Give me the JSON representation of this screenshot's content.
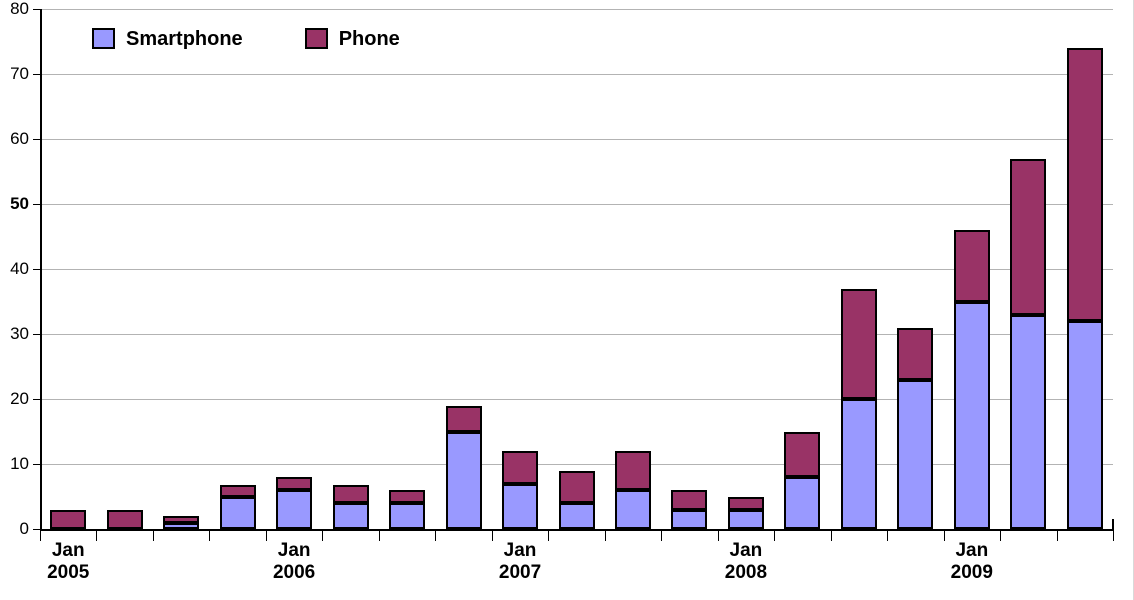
{
  "chart_data": {
    "type": "bar",
    "subtype": "stacked-bar",
    "title": "",
    "subtitle": "",
    "xlabel": "",
    "ylabel": "",
    "ylim": [
      0,
      80
    ],
    "y_ticks": [
      0,
      10,
      20,
      30,
      40,
      50,
      60,
      70,
      80
    ],
    "y_tick_labels": [
      "0",
      "10",
      "20",
      "30",
      "40",
      "50",
      "60",
      "70",
      "80"
    ],
    "y_tick_label_emphasis": "50",
    "grid": "horizontal",
    "legend_position": "top-left-inside",
    "legend": [
      "Smartphone",
      "Phone"
    ],
    "categories": [
      "Jan 2005",
      "",
      "",
      "",
      "Jan 2006",
      "",
      "",
      "",
      "Jan 2007",
      "",
      "",
      "",
      "Jan 2008",
      "",
      "",
      "",
      "Jan 2009",
      "",
      ""
    ],
    "x_tick_labels": [
      {
        "index": 0,
        "line1": "Jan",
        "line2": "2005"
      },
      {
        "index": 4,
        "line1": "Jan",
        "line2": "2006"
      },
      {
        "index": 8,
        "line1": "Jan",
        "line2": "2007"
      },
      {
        "index": 12,
        "line1": "Jan",
        "line2": "2008"
      },
      {
        "index": 16,
        "line1": "Jan",
        "line2": "2009"
      }
    ],
    "series": [
      {
        "name": "Smartphone",
        "color": "#9999FF",
        "values": [
          0,
          0,
          1,
          5,
          6,
          4,
          4,
          15,
          7,
          4,
          6,
          3,
          3,
          8,
          20,
          23,
          35,
          33,
          32
        ]
      },
      {
        "name": "Phone",
        "color": "#993366",
        "values": [
          3,
          3,
          1,
          1.8,
          2,
          2.8,
          2,
          4,
          5,
          5,
          6,
          3,
          2,
          7,
          17,
          8,
          11,
          24,
          42
        ]
      }
    ],
    "totals": [
      3,
      3,
      2,
      6.8,
      8,
      6.8,
      6,
      19,
      12,
      9,
      12,
      6,
      5,
      15,
      37,
      31,
      46,
      57,
      74
    ],
    "colors": {
      "smartphone": "#9999FF",
      "phone": "#993366",
      "bar_outline": "#000000",
      "gridline": "#b3b3b3",
      "axis": "#000000",
      "background": "#ffffff"
    }
  },
  "legend": {
    "entries": [
      {
        "label": "Smartphone",
        "color": "#9999FF",
        "icon": "legend-swatch-icon"
      },
      {
        "label": "Phone",
        "color": "#993366",
        "icon": "legend-swatch-icon"
      }
    ]
  }
}
